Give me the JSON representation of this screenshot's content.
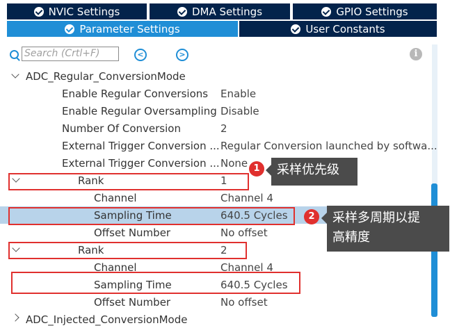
{
  "tabs": {
    "nvic": "NVIC Settings",
    "dma": "DMA Settings",
    "gpio": "GPIO Settings",
    "parameter": "Parameter Settings",
    "user_constants": "User Constants"
  },
  "toolbar": {
    "search_placeholder": "Search (Crtl+F)",
    "prev_icon": "prev-circle-icon",
    "next_icon": "next-circle-icon",
    "info_icon": "info-icon"
  },
  "tree": {
    "group_label": "ADC_Regular_ConversionMode",
    "rows": [
      {
        "label": "Enable Regular Conversions",
        "value": "Enable"
      },
      {
        "label": "Enable Regular Oversampling",
        "value": "Disable"
      },
      {
        "label": "Number Of Conversion",
        "value": "2"
      },
      {
        "label": "External Trigger Conversion ...",
        "value": "Regular Conversion launched by softwa..."
      },
      {
        "label": "External Trigger Conversion ...",
        "value": "None"
      }
    ],
    "rank1": {
      "label": "Rank",
      "value": "1",
      "channel_label": "Channel",
      "channel_value": "Channel 4",
      "sampling_label": "Sampling Time",
      "sampling_value": "640.5 Cycles",
      "offset_label": "Offset Number",
      "offset_value": "No offset"
    },
    "rank2": {
      "label": "Rank",
      "value": "2",
      "channel_label": "Channel",
      "channel_value": "Channel 4",
      "sampling_label": "Sampling Time",
      "sampling_value": "640.5 Cycles",
      "offset_label": "Offset Number",
      "offset_value": "No offset"
    },
    "next_group_partial": "ADC_Injected_ConversionMode"
  },
  "annotations": {
    "badge1": "1",
    "note1": "采样优先级",
    "badge2": "2",
    "note2_line1": "采样多周期以提",
    "note2_line2": "高精度"
  },
  "colors": {
    "tab_dark": "#03234b",
    "tab_active": "#1f8ed6",
    "highlight": "#e0302e",
    "selected_row": "#b8d3ea"
  }
}
